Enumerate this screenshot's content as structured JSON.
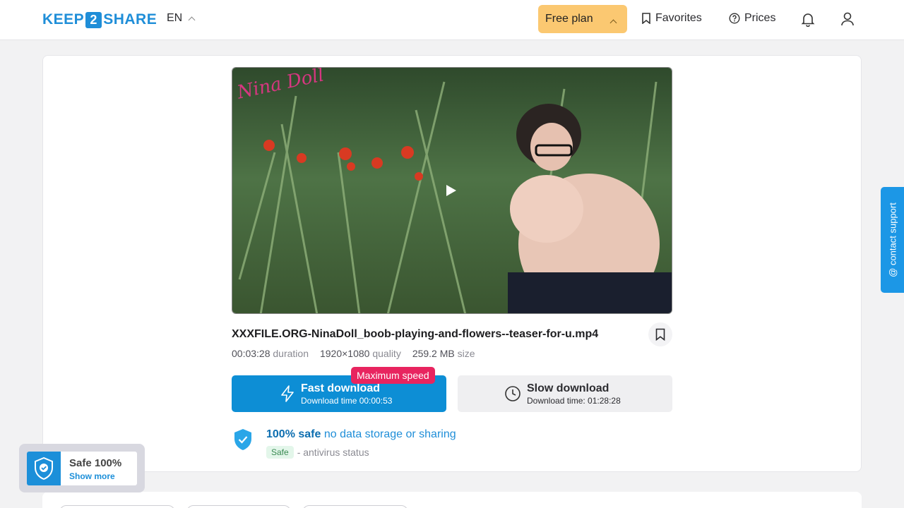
{
  "header": {
    "logo_left": "KEEP",
    "logo_num": "2",
    "logo_right": "SHARE",
    "lang": "EN",
    "plan_label": "Free plan",
    "favorites_label": "Favorites",
    "prices_label": "Prices"
  },
  "file": {
    "name": "XXXFILE.ORG-NinaDoll_boob-playing-and-flowers--teaser-for-u.mp4",
    "duration": "00:03:28",
    "duration_label": "duration",
    "quality": "1920×1080",
    "quality_label": "quality",
    "size": "259.2 MB",
    "size_label": "size"
  },
  "fast": {
    "title": "Fast download",
    "time": "Download time 00:00:53",
    "badge": "Maximum speed"
  },
  "slow": {
    "title": "Slow download",
    "time": "Download time: 01:28:28"
  },
  "safe": {
    "strong": "100% safe",
    "rest": "no data storage or sharing",
    "tag": "Safe",
    "status": "- antivirus status"
  },
  "support": {
    "label": "@ contact support"
  },
  "widget": {
    "title": "Safe 100%",
    "link": "Show more"
  },
  "colors": {
    "accent": "#0d8ed5",
    "plan": "#fbc871",
    "badge": "#e8245f"
  }
}
